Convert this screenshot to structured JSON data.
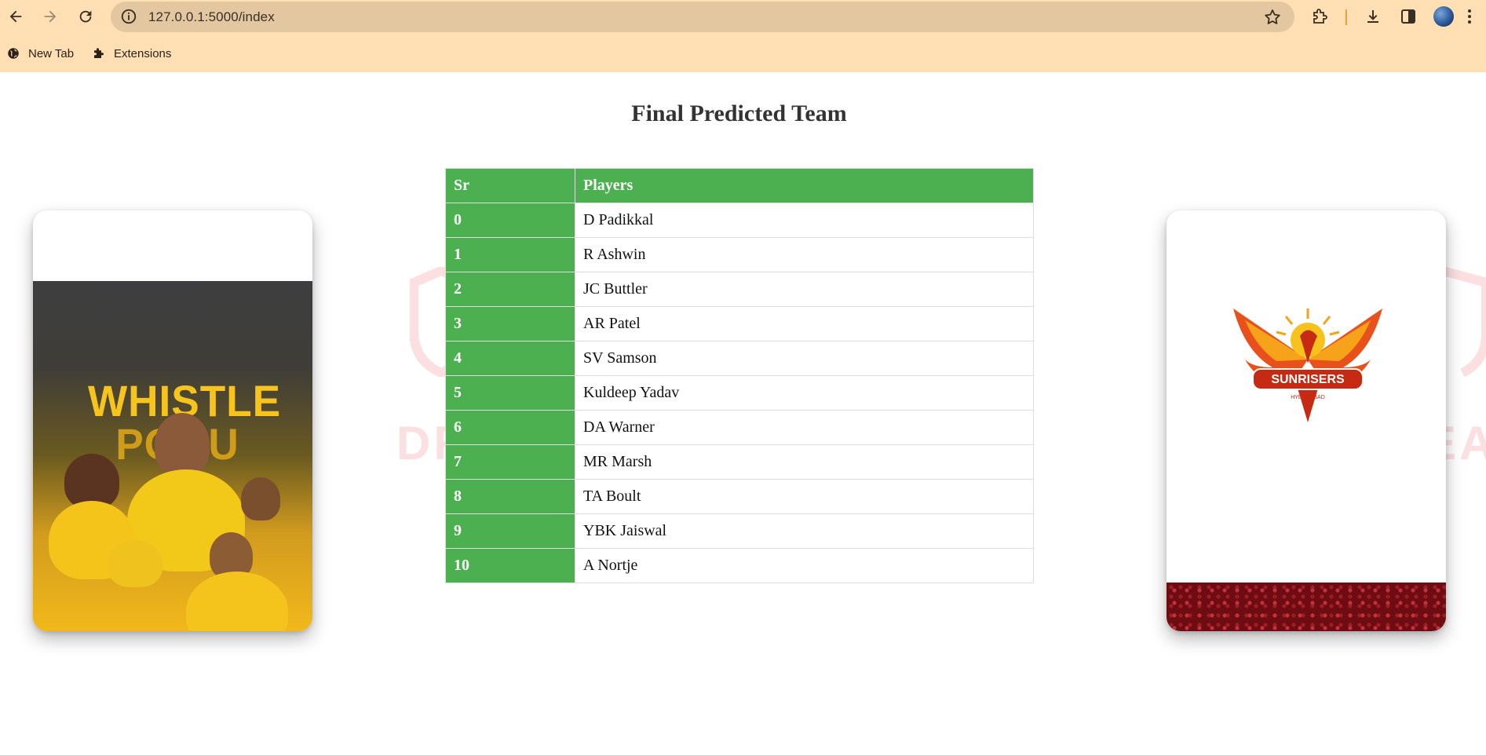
{
  "browser": {
    "url": "127.0.0.1:5000/index",
    "bookmarks": [
      {
        "label": "New Tab",
        "icon": "globe-icon"
      },
      {
        "label": "Extensions",
        "icon": "puzzle-icon"
      }
    ]
  },
  "page": {
    "title": "Final Predicted Team",
    "table": {
      "headers": [
        "Sr",
        "Players"
      ],
      "rows": [
        {
          "sr": "0",
          "player": "D Padikkal"
        },
        {
          "sr": "1",
          "player": "R Ashwin"
        },
        {
          "sr": "2",
          "player": "JC Buttler"
        },
        {
          "sr": "3",
          "player": "AR Patel"
        },
        {
          "sr": "4",
          "player": "SV Samson"
        },
        {
          "sr": "5",
          "player": "Kuldeep Yadav"
        },
        {
          "sr": "6",
          "player": "DA Warner"
        },
        {
          "sr": "7",
          "player": "MR Marsh"
        },
        {
          "sr": "8",
          "player": "TA Boult"
        },
        {
          "sr": "9",
          "player": "YBK Jaiswal"
        },
        {
          "sr": "10",
          "player": "A Nortje"
        }
      ]
    },
    "left_card": {
      "poster_text": [
        "WHISTLE",
        "PODU"
      ]
    },
    "right_card": {
      "logo_text": "SUNRISERS",
      "logo_subtext": "HYDERABAD"
    },
    "watermark": {
      "left": "DR",
      "right": "EA"
    }
  },
  "colors": {
    "header_green": "#4caf50",
    "chrome_bg": "#ffdfb3",
    "omnibox_bg": "#e2c7a0"
  }
}
